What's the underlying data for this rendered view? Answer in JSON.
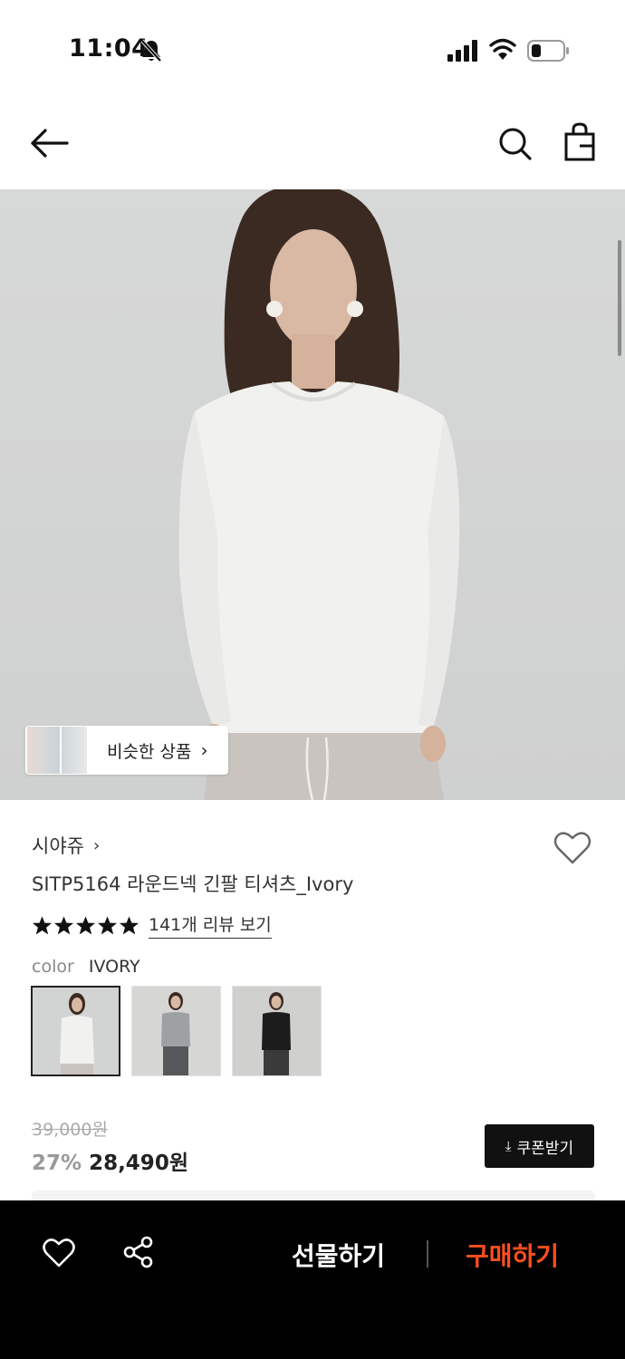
{
  "status_bar": {
    "time": "11:04",
    "icons": [
      "bell-slash-icon",
      "signal-icon",
      "wifi-icon",
      "battery-icon"
    ]
  },
  "header": {
    "icons": [
      "back-arrow-icon",
      "search-icon",
      "shopping-bag-icon"
    ]
  },
  "hero": {
    "similar_label": "비슷한 상품",
    "similar_arrow": "›"
  },
  "product": {
    "brand": "시야쥬",
    "brand_arrow": "›",
    "title": "SITP5164 라운드넥 긴팔 티셔츠_Ivory",
    "rating_stars": 5,
    "review_link": "141개 리뷰 보기",
    "color_key": "color",
    "color_value": "IVORY",
    "swatches": [
      {
        "color": "ivory",
        "selected": true
      },
      {
        "color": "grey",
        "selected": false
      },
      {
        "color": "black",
        "selected": false
      }
    ],
    "price_original": "39,000원",
    "discount": "27%",
    "price_now": "28,490원",
    "coupon_label": "쿠폰받기",
    "coupon_icon": "⤓"
  },
  "bottom_bar": {
    "gift_label": "선물하기",
    "buy_label": "구매하기"
  },
  "colors": {
    "accent": "#ff4f1f",
    "bottom_bar_bg": "#000000"
  }
}
